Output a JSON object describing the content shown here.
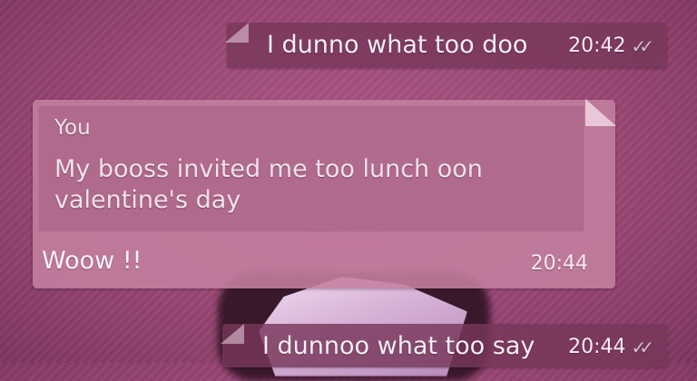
{
  "messages": [
    {
      "text": "I dunno what too doo",
      "time": "20:42",
      "status_icon": "double-check-icon"
    },
    {
      "quote": {
        "author": "You",
        "text": "My booss invited me too lunch oon valentine's day"
      },
      "text": "Woow !!",
      "time": "20:44"
    },
    {
      "text": "I dunnoo what too say",
      "time": "20:44",
      "status_icon": "double-check-icon"
    }
  ]
}
